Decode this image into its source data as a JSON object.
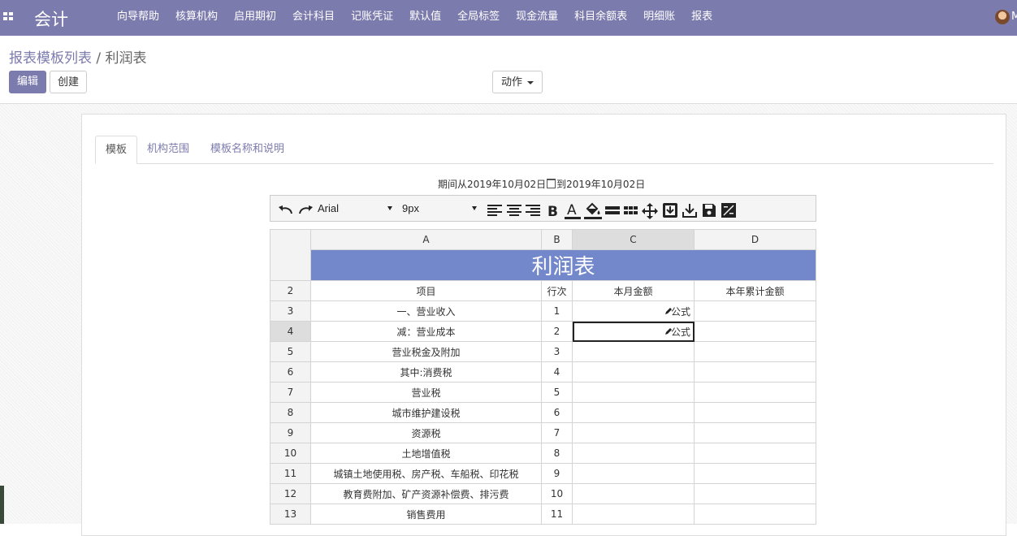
{
  "app": {
    "title": "会计",
    "user_initial": "M"
  },
  "menu": [
    "向导帮助",
    "核算机构",
    "启用期初",
    "会计科目",
    "记账凭证",
    "默认值",
    "全局标签",
    "现金流量",
    "科目余额表",
    "明细账",
    "报表"
  ],
  "breadcrumb": {
    "parent": "报表模板列表",
    "separator": " / ",
    "current": "利润表"
  },
  "buttons": {
    "edit": "编辑",
    "create": "创建",
    "action": "动作"
  },
  "tabs": [
    "模板",
    "机构范围",
    "模板名称和说明"
  ],
  "period": {
    "prefix": "期间从",
    "from": "2019年10月02日",
    "to_word": "到",
    "to": "2019年10月02日"
  },
  "toolbar": {
    "font": "Arial",
    "size": "9px"
  },
  "sheet": {
    "columns": [
      "A",
      "B",
      "C",
      "D"
    ],
    "title": "利润表",
    "header": {
      "row": "2",
      "a": "项目",
      "b": "行次",
      "c": "本月金额",
      "d": "本年累计金额"
    },
    "rows": [
      {
        "row": "3",
        "a": "一、营业收入",
        "b": "1",
        "c": "公式",
        "d": ""
      },
      {
        "row": "4",
        "a": "减：营业成本",
        "b": "2",
        "c": "公式",
        "d": ""
      },
      {
        "row": "5",
        "a": "营业税金及附加",
        "b": "3",
        "c": "",
        "d": ""
      },
      {
        "row": "6",
        "a": "其中:消费税",
        "b": "4",
        "c": "",
        "d": ""
      },
      {
        "row": "7",
        "a": "营业税",
        "b": "5",
        "c": "",
        "d": ""
      },
      {
        "row": "8",
        "a": "城市维护建设税",
        "b": "6",
        "c": "",
        "d": ""
      },
      {
        "row": "9",
        "a": "资源税",
        "b": "7",
        "c": "",
        "d": ""
      },
      {
        "row": "10",
        "a": "土地增值税",
        "b": "8",
        "c": "",
        "d": ""
      },
      {
        "row": "11",
        "a": "城镇土地使用税、房产税、车船税、印花税",
        "b": "9",
        "c": "",
        "d": ""
      },
      {
        "row": "12",
        "a": "教育费附加、矿产资源补偿费、排污费",
        "b": "10",
        "c": "",
        "d": ""
      },
      {
        "row": "13",
        "a": "销售费用",
        "b": "11",
        "c": "",
        "d": ""
      }
    ]
  }
}
